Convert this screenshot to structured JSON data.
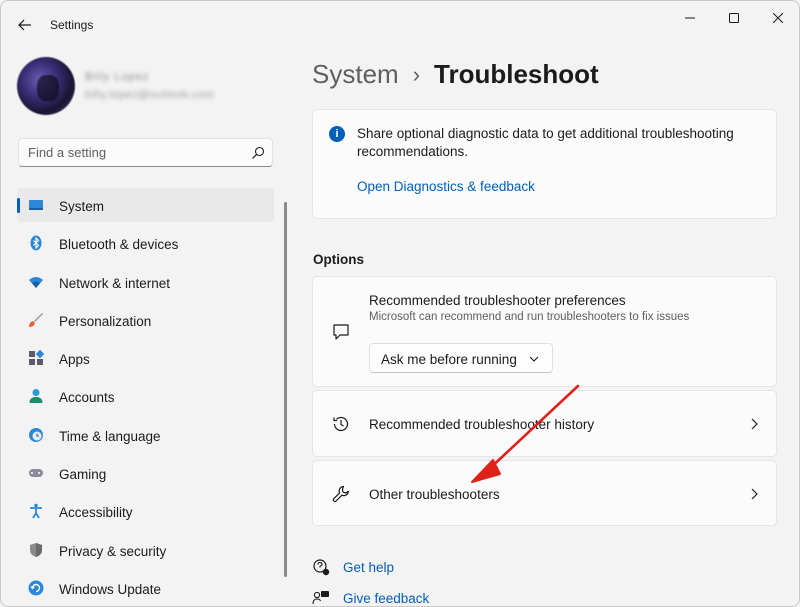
{
  "window": {
    "title": "Settings"
  },
  "profile": {
    "name": "Billy Lopez",
    "email": "billy.lopez@outlook.com"
  },
  "search": {
    "placeholder": "Find a setting"
  },
  "nav": {
    "items": [
      {
        "label": "System",
        "icon": "monitor-icon",
        "selected": true
      },
      {
        "label": "Bluetooth & devices",
        "icon": "bluetooth-icon"
      },
      {
        "label": "Network & internet",
        "icon": "wifi-icon"
      },
      {
        "label": "Personalization",
        "icon": "paintbrush-icon"
      },
      {
        "label": "Apps",
        "icon": "apps-icon"
      },
      {
        "label": "Accounts",
        "icon": "person-icon"
      },
      {
        "label": "Time & language",
        "icon": "globe-clock-icon"
      },
      {
        "label": "Gaming",
        "icon": "gamepad-icon"
      },
      {
        "label": "Accessibility",
        "icon": "accessibility-icon"
      },
      {
        "label": "Privacy & security",
        "icon": "shield-icon"
      },
      {
        "label": "Windows Update",
        "icon": "update-icon"
      }
    ]
  },
  "breadcrumb": {
    "parent": "System",
    "separator": "›",
    "current": "Troubleshoot"
  },
  "info_card": {
    "text": "Share optional diagnostic data to get additional troubleshooting recommendations.",
    "link": "Open Diagnostics & feedback"
  },
  "options": {
    "section_label": "Options",
    "preferences": {
      "title": "Recommended troubleshooter preferences",
      "description": "Microsoft can recommend and run troubleshooters to fix issues",
      "dropdown_value": "Ask me before running"
    },
    "history": {
      "label": "Recommended troubleshooter history"
    },
    "other": {
      "label": "Other troubleshooters"
    }
  },
  "help": {
    "get_help": "Get help",
    "give_feedback": "Give feedback"
  },
  "colors": {
    "accent": "#005fb8",
    "annotation_arrow": "#e0201b"
  }
}
